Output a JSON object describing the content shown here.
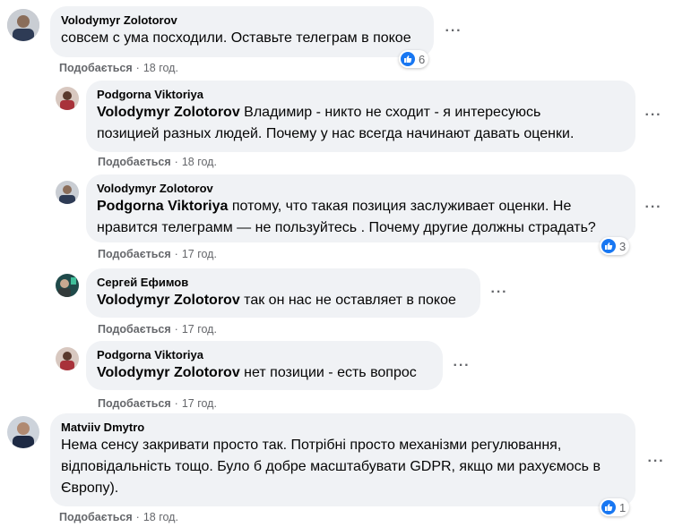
{
  "comments": [
    {
      "author": "Volodymyr Zolotorov",
      "mention": "",
      "text": "совсем с ума посходили. Оставьте телеграм в покое",
      "like_label": "Подобається",
      "time": "18 год.",
      "reactions": "6"
    },
    {
      "author": "Podgorna Viktoriya",
      "mention": "Volodymyr Zolotorov",
      "text_line1": "Владимир - никто не сходит - я интересуюсь",
      "text_line2": "позицией разных людей. Почему у нас всегда начинают давать оценки.",
      "like_label": "Подобається",
      "time": "18 год."
    },
    {
      "author": "Volodymyr Zolotorov",
      "mention": "Podgorna Viktoriya",
      "text_line1": "потому, что такая позиция заслуживает оценки. Не",
      "text_line2": "нравится телеграмм — не пользуйтесь . Почему другие должны страдать?",
      "like_label": "Подобається",
      "time": "17 год.",
      "reactions": "3"
    },
    {
      "author": "Сергей Ефимов",
      "mention": "Volodymyr Zolotorov",
      "text": "так он нас не оставляет в покое",
      "like_label": "Подобається",
      "time": "17 год."
    },
    {
      "author": "Podgorna Viktoriya",
      "mention": "Volodymyr Zolotorov",
      "text": "нет позиции - есть вопрос",
      "like_label": "Подобається",
      "time": "17 год."
    },
    {
      "author": "Matviiv Dmytro",
      "mention": "",
      "text_line1": "Нема сенсу закривати просто так. Потрібні просто механізми регулювання,",
      "text_line2": "відповідальність тощо. Було б добре масштабувати GDPR, якщо ми рахуємось в",
      "text_line3": "Європу).",
      "like_label": "Подобається",
      "time": "18 год.",
      "reactions": "1"
    }
  ],
  "separator": "·",
  "more_icon": "more-options-icon",
  "like_icon": "thumbs-up-icon",
  "colors": {
    "bubble": "#f0f2f5",
    "meta_text": "#65676b",
    "like_blue": "#1877f2"
  }
}
